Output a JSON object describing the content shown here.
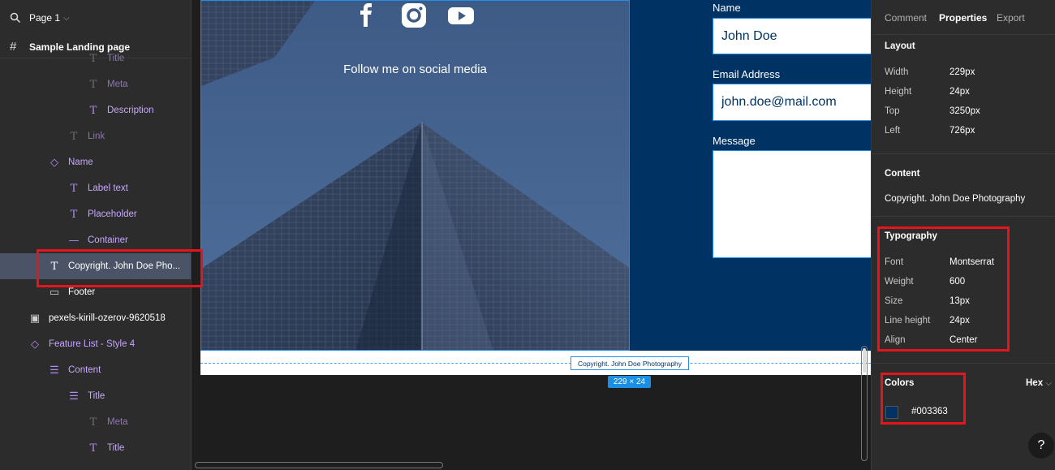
{
  "left_panel": {
    "page_label": "Page 1",
    "file_name": "Sample Landing page",
    "layers": [
      {
        "label": "Title",
        "style": "dim"
      },
      {
        "label": "Meta",
        "style": "dim"
      },
      {
        "label": "Description",
        "style": "purple"
      },
      {
        "label": "Link",
        "style": "dim"
      },
      {
        "label": "Name",
        "style": "purple"
      },
      {
        "label": "Label text",
        "style": "purple"
      },
      {
        "label": "Placeholder",
        "style": "purple"
      },
      {
        "label": "Container",
        "style": "purple"
      },
      {
        "label": "Copyright. John Doe Pho...",
        "style": "selected"
      },
      {
        "label": "Footer",
        "style": "white"
      },
      {
        "label": "pexels-kirill-ozerov-9620518",
        "style": "white"
      },
      {
        "label": "Feature List - Style 4",
        "style": "purple"
      },
      {
        "label": "Content",
        "style": "purple"
      },
      {
        "label": "Title",
        "style": "purple"
      },
      {
        "label": "Meta",
        "style": "dim"
      },
      {
        "label": "Title",
        "style": "purple"
      }
    ]
  },
  "canvas": {
    "follow_text": "Follow me on social media",
    "form": {
      "name_label": "Name",
      "name_value": "John Doe",
      "email_label": "Email Address",
      "email_value": "john.doe@mail.com",
      "message_label": "Message"
    },
    "copyright_text": "Copyright. John Doe Photography",
    "selection_size": "229 × 24"
  },
  "right_panel": {
    "tabs": [
      "Comment",
      "Properties",
      "Export"
    ],
    "active_tab": "Properties",
    "layout": {
      "title": "Layout",
      "rows": [
        {
          "key": "Width",
          "value": "229px"
        },
        {
          "key": "Height",
          "value": "24px"
        },
        {
          "key": "Top",
          "value": "3250px"
        },
        {
          "key": "Left",
          "value": "726px"
        }
      ]
    },
    "content": {
      "title": "Content",
      "text": "Copyright. John Doe Photography"
    },
    "typography": {
      "title": "Typography",
      "rows": [
        {
          "key": "Font",
          "value": "Montserrat"
        },
        {
          "key": "Weight",
          "value": "600"
        },
        {
          "key": "Size",
          "value": "13px"
        },
        {
          "key": "Line height",
          "value": "24px"
        },
        {
          "key": "Align",
          "value": "Center"
        }
      ]
    },
    "colors": {
      "title": "Colors",
      "format": "Hex",
      "swatch": "#003363",
      "hex_value": "#003363"
    },
    "help": "?"
  },
  "colors": {
    "brand_navy": "#003363",
    "selection_blue": "#1f8fe8",
    "highlight_red": "#e8141b"
  }
}
